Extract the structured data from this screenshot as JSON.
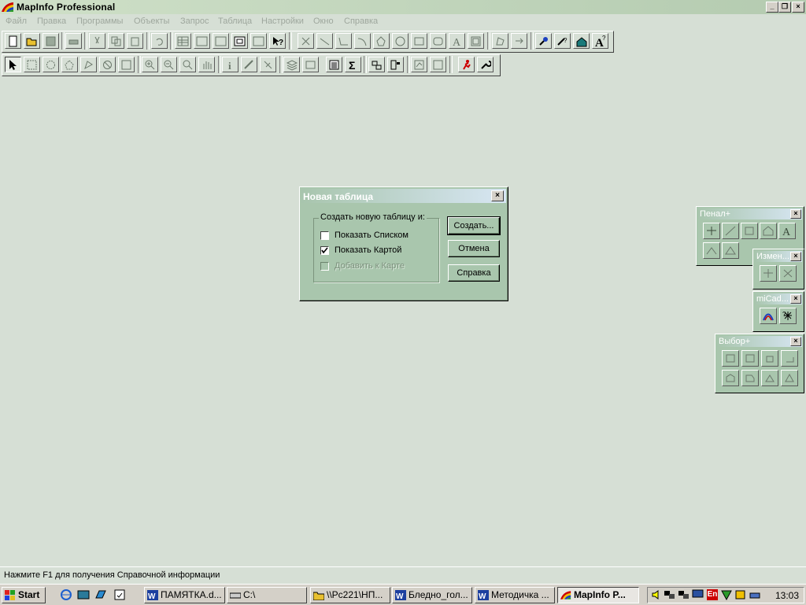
{
  "window": {
    "title": "MapInfo Professional"
  },
  "menu": [
    "Файл",
    "Правка",
    "Программы",
    "Объекты",
    "Запрос",
    "Таблица",
    "Настройки",
    "Окно",
    "Справка"
  ],
  "dialog": {
    "title": "Новая таблица",
    "group_label": "Создать новую таблицу и:",
    "options": [
      {
        "label": "Показать Списком",
        "checked": false,
        "enabled": true
      },
      {
        "label": "Показать Картой",
        "checked": true,
        "enabled": true
      },
      {
        "label": "Добавить к Карте",
        "checked": false,
        "enabled": false
      }
    ],
    "buttons": {
      "create": "Создать...",
      "cancel": "Отмена",
      "help": "Справка"
    }
  },
  "palettes": {
    "penal": "Пенал+",
    "izmen": "Измен...",
    "micad": "miCad...",
    "vybor": "Выбор+"
  },
  "status_bar": "Нажмите F1 для получения Справочной информации",
  "taskbar": {
    "start": "Start",
    "tasks": [
      "ПАМЯТКА.d...",
      "C:\\",
      "\\\\Pc221\\НП...",
      "Бледно_гол...",
      "Методичка ...",
      "MapInfo P..."
    ],
    "clock": "13:03"
  },
  "colors": {
    "workspace": "#d6dfd5",
    "dialog": "#a9c6ad",
    "title_gradient_end": "#d7e6f3"
  }
}
